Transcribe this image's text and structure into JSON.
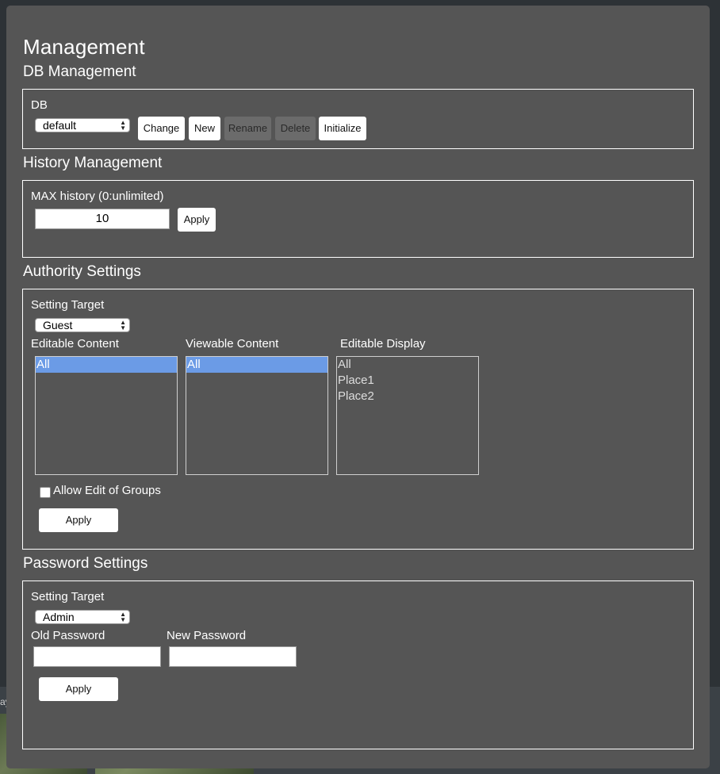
{
  "background": {
    "label": "ay"
  },
  "modal": {
    "title": "Management"
  },
  "db_management": {
    "heading": "DB Management",
    "db_label": "DB",
    "db_select_value": "default",
    "buttons": {
      "change": "Change",
      "new": "New",
      "rename": "Rename",
      "delete": "Delete",
      "initialize": "Initialize"
    }
  },
  "history_management": {
    "heading": "History Management",
    "max_label": "MAX history (0:unlimited)",
    "max_value": "10",
    "apply": "Apply"
  },
  "authority_settings": {
    "heading": "Authority Settings",
    "target_label": "Setting Target",
    "target_value": "Guest",
    "editable_content_label": "Editable Content",
    "viewable_content_label": "Viewable Content",
    "editable_display_label": "Editable Display",
    "editable_content_options": [
      {
        "label": "All",
        "selected": true
      }
    ],
    "viewable_content_options": [
      {
        "label": "All",
        "selected": true
      }
    ],
    "editable_display_options": [
      {
        "label": "All",
        "selected": false
      },
      {
        "label": "Place1",
        "selected": false
      },
      {
        "label": "Place2",
        "selected": false
      }
    ],
    "allow_edit_groups_label": "Allow Edit of Groups",
    "allow_edit_groups_checked": false,
    "apply": "Apply"
  },
  "password_settings": {
    "heading": "Password Settings",
    "target_label": "Setting Target",
    "target_value": "Admin",
    "old_password_label": "Old Password",
    "new_password_label": "New Password",
    "old_password_value": "",
    "new_password_value": "",
    "apply": "Apply"
  },
  "colors": {
    "modal_bg": "#555555",
    "selected_option": "#6b9be6",
    "disabled_button": "#6b6b6b"
  }
}
